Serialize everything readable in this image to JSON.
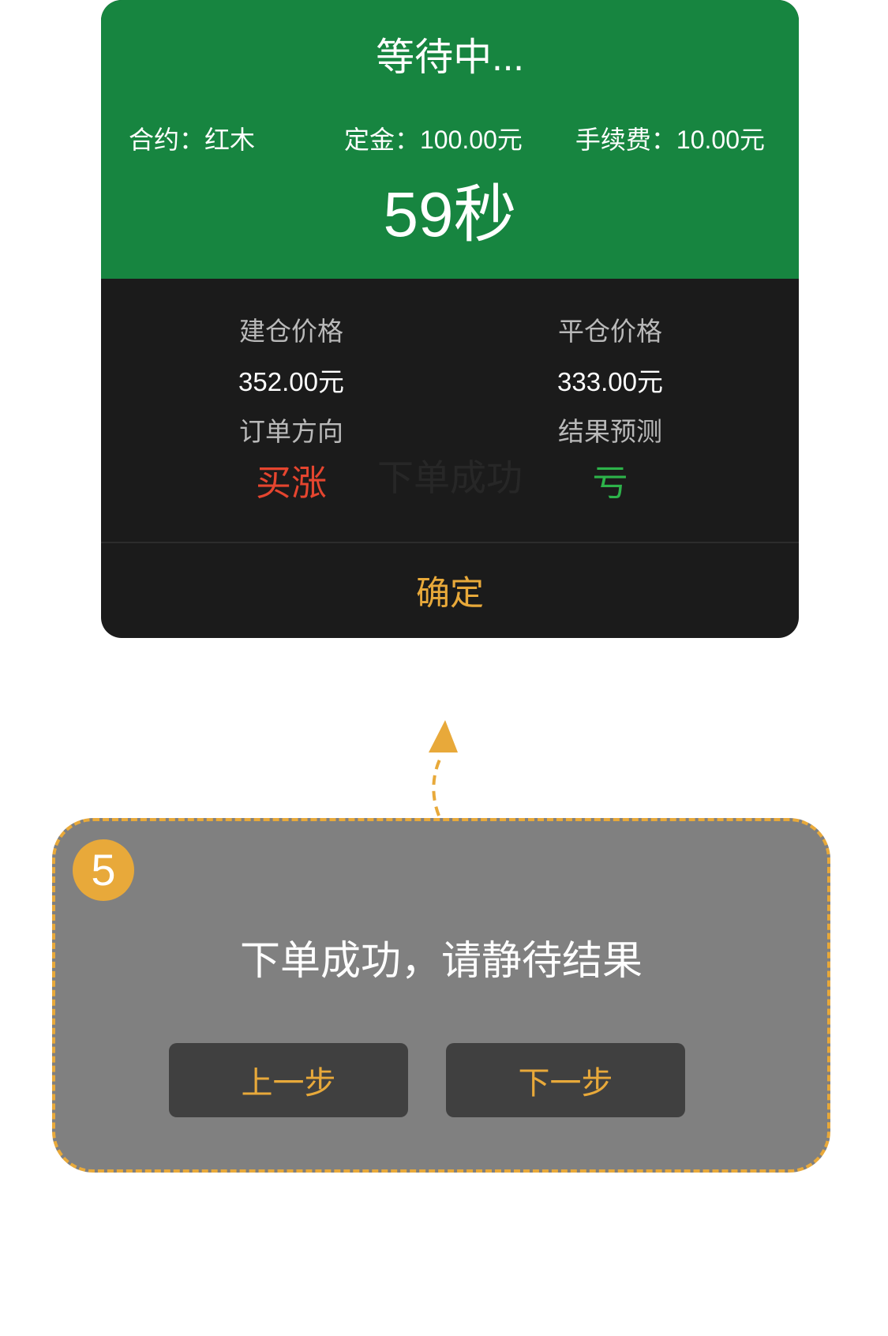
{
  "dialog": {
    "title": "等待中...",
    "contract": "合约：红木",
    "deposit": "定金：100.00元",
    "fee": "手续费：10.00元",
    "countdown": "59秒",
    "open_price_label": "建仓价格",
    "open_price_value": "352.00元",
    "close_price_label": "平仓价格",
    "close_price_value": "333.00元",
    "direction_label": "订单方向",
    "direction_value": "买涨",
    "prediction_label": "结果预测",
    "prediction_value": "亏",
    "watermark": "下单成功",
    "confirm_label": "确定"
  },
  "guide": {
    "step_number": "5",
    "message": "下单成功，请静待结果",
    "prev_label": "上一步",
    "next_label": "下一步",
    "arrow_icon": "arrow-up-icon"
  },
  "colors": {
    "green": "#178540",
    "dark": "#1b1b1b",
    "orange": "#E8A93A",
    "red": "#E5452F",
    "profit-green": "#2DB34A",
    "guide-bg": "#808080",
    "btn-bg": "#404040"
  }
}
